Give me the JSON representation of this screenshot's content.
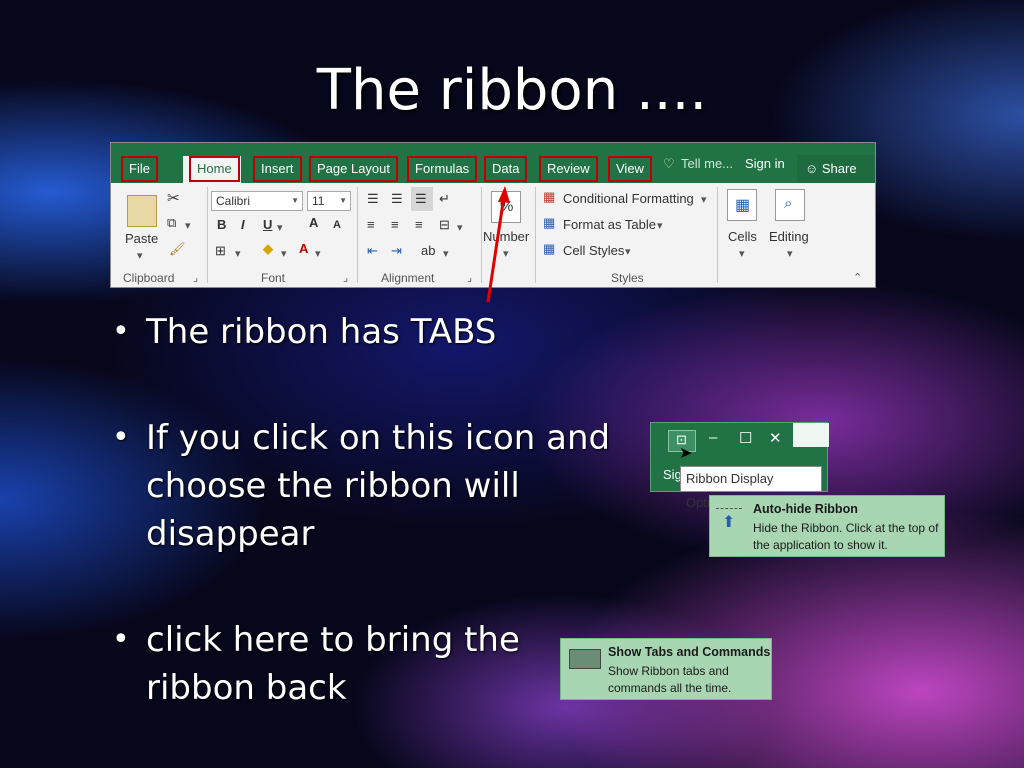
{
  "slide": {
    "title": "The ribbon ....",
    "bullets": [
      "The ribbon has TABS",
      "If you click on this icon and choose the ribbon will disappear",
      "click here to bring the ribbon back"
    ]
  },
  "ribbon": {
    "tabs": [
      "File",
      "Home",
      "Insert",
      "Page Layout",
      "Formulas",
      "Data",
      "Review",
      "View"
    ],
    "tell_me": "Tell me...",
    "sign_in": "Sign in",
    "share": "Share",
    "font_name": "Calibri",
    "font_size": "11",
    "paste_label": "Paste",
    "number_label": "Number",
    "cells_label": "Cells",
    "editing_label": "Editing",
    "styles_items": [
      "Conditional Formatting",
      "Format as Table",
      "Cell Styles"
    ],
    "group_labels": {
      "clipboard": "Clipboard",
      "font": "Font",
      "alignment": "Alignment",
      "styles": "Styles"
    },
    "accent_color": "#217346",
    "highlight_color": "#c00000"
  },
  "window_controls": {
    "minimize": "–",
    "maximize": "☐",
    "close": "✕",
    "partial_text": "Sig",
    "tooltip": "Ribbon Display Options"
  },
  "auto_hide": {
    "title": "Auto-hide Ribbon",
    "desc": "Hide the Ribbon. Click at the top of the application to show it."
  },
  "show_tabs": {
    "title": "Show Tabs and Commands",
    "desc": "Show Ribbon tabs and commands all the time."
  }
}
